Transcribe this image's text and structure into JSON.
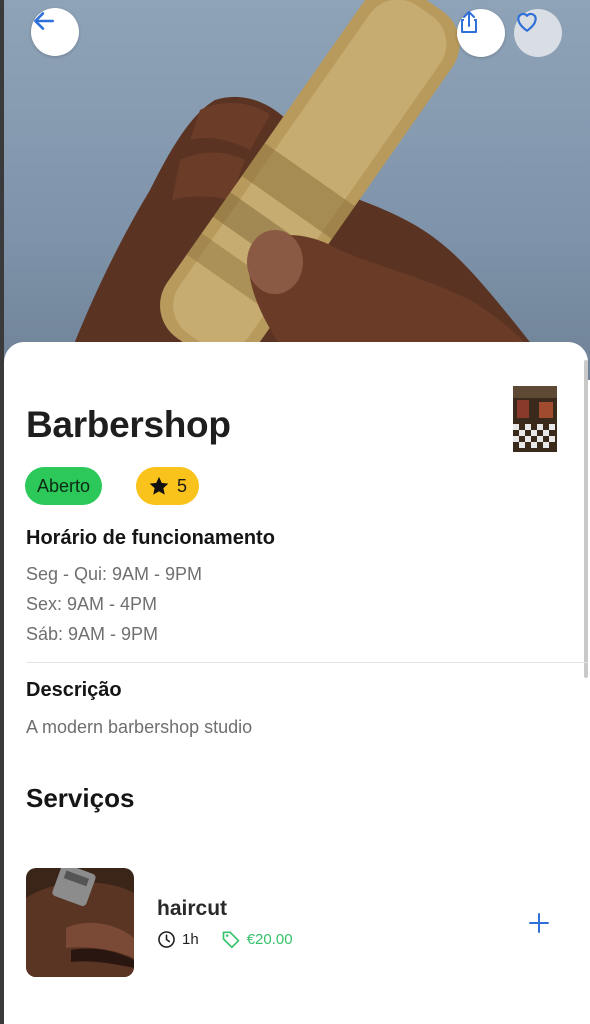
{
  "shop": {
    "name": "Barbershop",
    "status": "Aberto",
    "rating": "5"
  },
  "hours": {
    "title": "Horário de funcionamento",
    "lines": [
      "Seg - Qui: 9AM - 9PM",
      "Sex: 9AM - 4PM",
      "Sáb: 9AM - 9PM"
    ]
  },
  "description": {
    "title": "Descrição",
    "text": "A modern barbershop studio"
  },
  "services": {
    "title": "Serviços",
    "items": [
      {
        "name": "haircut",
        "duration": "1h",
        "price": "€20.00"
      }
    ]
  },
  "icons": {
    "back": "arrow-left-icon",
    "share": "share-icon",
    "favorite": "heart-icon",
    "rating": "star-icon",
    "duration": "clock-icon",
    "price": "tag-icon",
    "add": "plus-icon"
  },
  "colors": {
    "accent": "#2f6fd8",
    "open_badge": "#2cc85a",
    "rating_badge": "#f9c31c",
    "price": "#35c36a"
  }
}
